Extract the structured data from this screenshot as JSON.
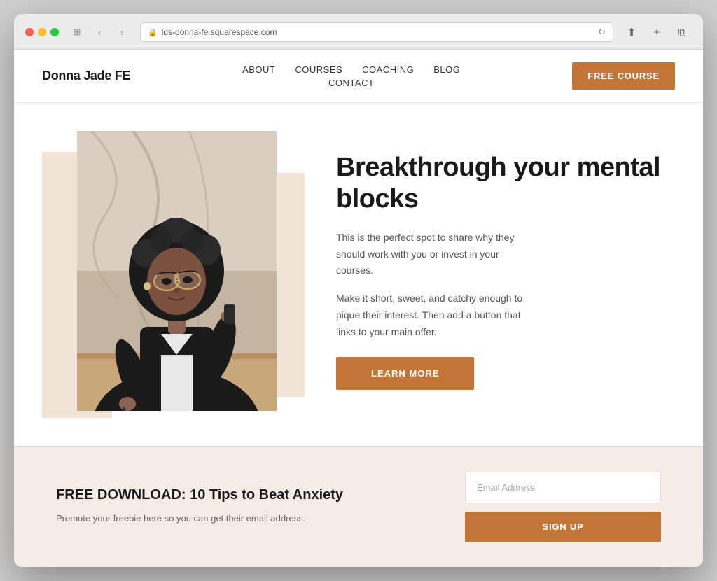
{
  "browser": {
    "url": "lds-donna-fe.squarespace.com",
    "reload_icon": "↻"
  },
  "header": {
    "logo": "Donna Jade FE",
    "nav": {
      "items": [
        {
          "label": "ABOUT",
          "id": "about"
        },
        {
          "label": "COURSES",
          "id": "courses"
        },
        {
          "label": "COACHING",
          "id": "coaching"
        },
        {
          "label": "BLOG",
          "id": "blog"
        },
        {
          "label": "CONTACT",
          "id": "contact"
        }
      ]
    },
    "cta_button": "FREE COURSE"
  },
  "hero": {
    "title": "Breakthrough your mental blocks",
    "paragraph1": "This is the perfect spot to share why they should work with you or invest in your courses.",
    "paragraph2": "Make it short, sweet, and catchy enough to pique their interest. Then add a button that links to your main offer.",
    "cta_button": "LEARN MORE"
  },
  "download": {
    "title": "FREE DOWNLOAD: 10 Tips to Beat Anxiety",
    "description": "Promote your freebie here so you can get their email address.",
    "email_placeholder": "Email Address",
    "signup_button": "SIGN UP"
  }
}
